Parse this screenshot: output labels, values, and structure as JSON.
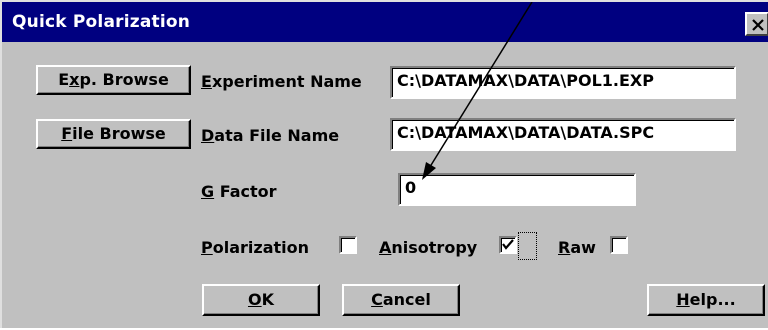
{
  "dialog": {
    "title": "Quick Polarization"
  },
  "buttons": {
    "exp_browse": "Exp. Browse",
    "file_browse": "File Browse",
    "ok": "OK",
    "cancel": "Cancel",
    "help": "Help..."
  },
  "fields": {
    "experiment_name": {
      "label": "Experiment Name",
      "value": "C:\\DATAMAX\\DATA\\POL1.EXP"
    },
    "data_file_name": {
      "label": "Data File Name",
      "value": "C:\\DATAMAX\\DATA\\DATA.SPC"
    },
    "g_factor": {
      "label": "G Factor",
      "value": "0"
    }
  },
  "options": [
    {
      "label": "Polarization",
      "checked": false
    },
    {
      "label": "Anisotropy",
      "checked": true
    },
    {
      "label": "Raw",
      "checked": false
    }
  ],
  "colors": {
    "titlebar": "#000080",
    "dialog_bg": "#c0c0c0",
    "field_bg": "#ffffff"
  }
}
